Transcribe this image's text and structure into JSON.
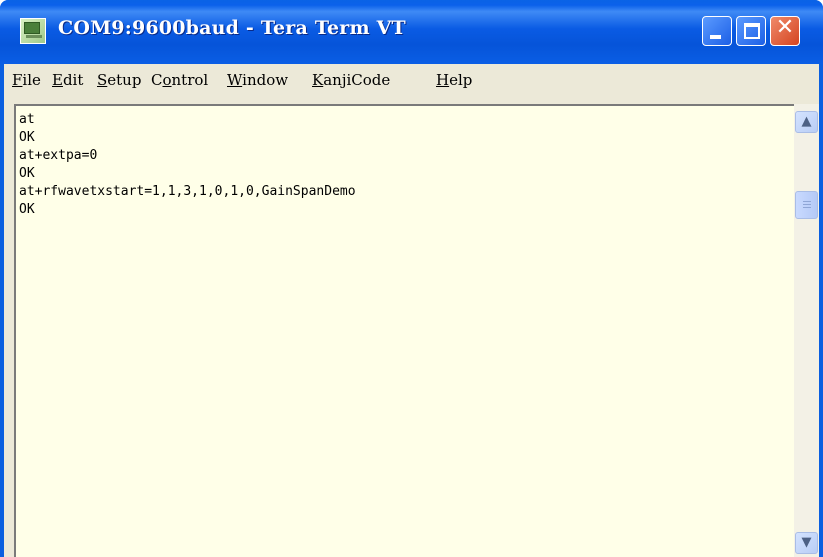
{
  "window": {
    "title": "COM9:9600baud - Tera Term VT"
  },
  "menubar": {
    "items": [
      {
        "label": "File",
        "accel": "F",
        "rest": "ile"
      },
      {
        "label": "Edit",
        "accel": "E",
        "rest": "dit"
      },
      {
        "label": "Setup",
        "accel": "S",
        "rest": "etup"
      },
      {
        "label": "Control",
        "accel": "o",
        "pre": "C",
        "rest": "ntrol"
      },
      {
        "label": "Window",
        "accel": "W",
        "rest": "indow"
      },
      {
        "label": "KanjiCode",
        "accel": "K",
        "rest": "anjiCode"
      },
      {
        "label": "Help",
        "accel": "H",
        "rest": "elp"
      }
    ]
  },
  "terminal": {
    "lines": [
      "at",
      "OK",
      "at+extpa=0",
      "OK",
      "at+rfwavetxstart=1,1,3,1,0,1,0,GainSpanDemo",
      "OK"
    ]
  },
  "icons": {
    "app": "tera-term-icon",
    "minimize": "minimize-icon",
    "maximize": "maximize-icon",
    "close": "close-icon",
    "scroll_up": "arrow-up-icon",
    "scroll_down": "arrow-down-icon"
  },
  "colors": {
    "titlebar": "#0a5fe0",
    "terminal_bg": "#ffffe8",
    "menubar_bg": "#ece9d8",
    "close_button": "#d44420"
  }
}
